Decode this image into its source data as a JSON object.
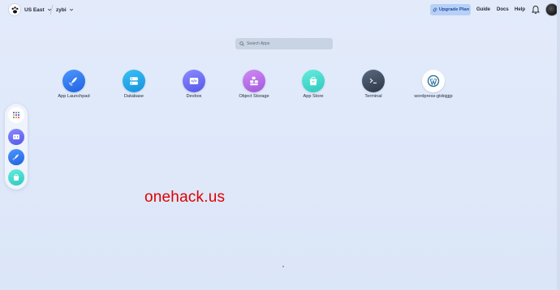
{
  "topbar": {
    "region": "US East",
    "workspace": "zybi",
    "upgrade_label": "Upgrade Plan",
    "nav": [
      "Guide",
      "Docs",
      "Help"
    ]
  },
  "search": {
    "placeholder": "Search Apps"
  },
  "apps": [
    {
      "label": "App Launchpad",
      "icon": "rocket-icon",
      "color": "#2f7df2"
    },
    {
      "label": "Database",
      "icon": "database-icon",
      "color": "#1fa3e8"
    },
    {
      "label": "Devbox",
      "icon": "devbox-icon",
      "color": "#6b6ef5"
    },
    {
      "label": "Object Storage",
      "icon": "object-storage-icon",
      "color": "#b96de8"
    },
    {
      "label": "App Store",
      "icon": "shopping-bag-icon",
      "color": "#3fd8c9"
    },
    {
      "label": "Terminal",
      "icon": "terminal-icon",
      "color": "#3d4a5c"
    },
    {
      "label": "wordpress-gtdojgjp",
      "icon": "wordpress-icon",
      "color": "#2a6f9a"
    }
  ],
  "dock": [
    "grid-icon",
    "devbox-icon",
    "rocket-icon",
    "shopping-bag-icon"
  ],
  "watermark": "onehack.us"
}
